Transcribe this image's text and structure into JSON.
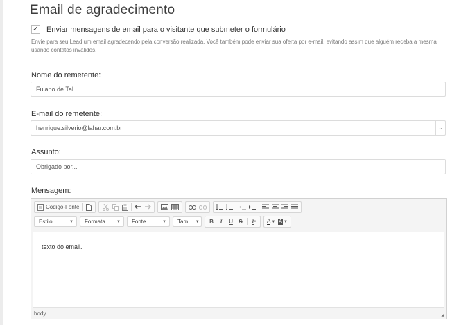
{
  "section": {
    "title": "Email de agradecimento",
    "checkbox_label": "Enviar mensagens de email para o visitante que submeter o formulário",
    "checkbox_mark": "✓",
    "help_text": "Envie para seu Lead um email agradecendo pela conversão realizada. Você também pode enviar sua oferta por e-mail, evitando assim que alguém receba a mesma usando contatos inválidos."
  },
  "fields": {
    "sender_name": {
      "label": "Nome do remetente:",
      "value": "Fulano de Tal"
    },
    "sender_email": {
      "label": "E-mail do remetente:",
      "value": "henrique.silverio@lahar.com.br"
    },
    "subject": {
      "label": "Assunto:",
      "value": "Obrigado por..."
    },
    "message": {
      "label": "Mensagem:"
    }
  },
  "editor": {
    "source_label": "Código-Fonte",
    "combos": [
      "Estilo",
      "Formata...",
      "Fonte",
      "Tam..."
    ],
    "body_text": "texto do email.",
    "status": "body"
  }
}
